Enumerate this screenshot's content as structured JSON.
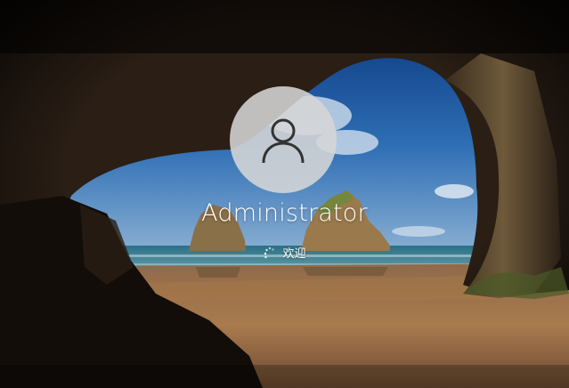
{
  "login": {
    "username": "Administrator",
    "status_text": "欢迎"
  },
  "icons": {
    "avatar": "user-icon",
    "spinner": "loading-spinner-icon"
  },
  "colors": {
    "avatar_bg": "#d6d6d6",
    "avatar_icon": "#333333",
    "text": "#ffffff",
    "sky": "#2f6fb5",
    "sea": "#3f8fa8",
    "sand": "#9c7048",
    "cave": "#1a130e"
  }
}
